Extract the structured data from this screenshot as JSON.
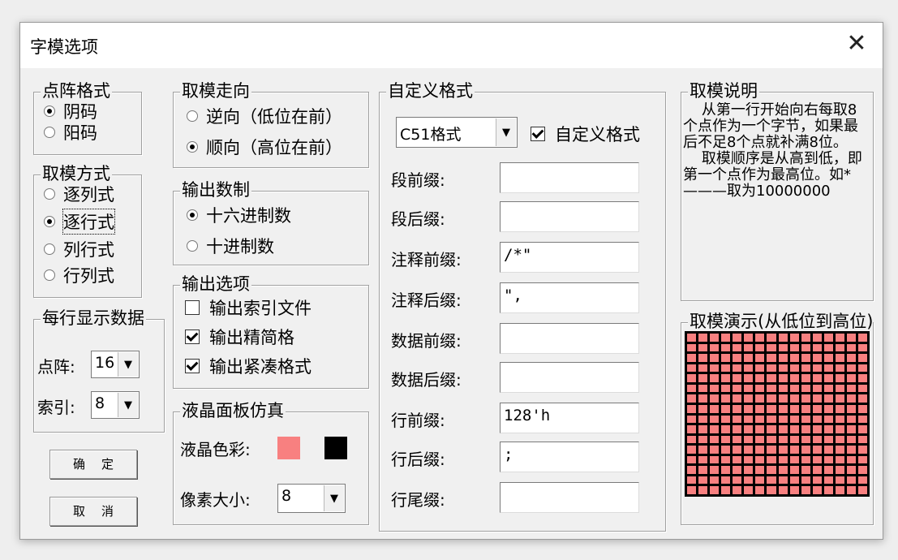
{
  "window": {
    "title": "字模选项",
    "close_glyph": "✕"
  },
  "dot_format": {
    "title": "点阵格式",
    "options": [
      {
        "label": "阴码",
        "selected": true
      },
      {
        "label": "阳码",
        "selected": false
      }
    ]
  },
  "mode": {
    "title": "取模方式",
    "options": [
      {
        "label": "逐列式",
        "selected": false
      },
      {
        "label": "逐行式",
        "selected": true
      },
      {
        "label": "列行式",
        "selected": false
      },
      {
        "label": "行列式",
        "selected": false
      }
    ]
  },
  "per_line": {
    "title": "每行显示数据",
    "dot_label": "点阵:",
    "dot_value": "16",
    "index_label": "索引:",
    "index_value": "8"
  },
  "buttons": {
    "ok": "确定",
    "cancel": "取消"
  },
  "direction": {
    "title": "取模走向",
    "options": [
      {
        "label": "逆向（低位在前）",
        "selected": false
      },
      {
        "label": "顺向（高位在前）",
        "selected": true
      }
    ]
  },
  "radix": {
    "title": "输出数制",
    "options": [
      {
        "label": "十六进制数",
        "selected": true
      },
      {
        "label": "十进制数",
        "selected": false
      }
    ]
  },
  "output": {
    "title": "输出选项",
    "options": [
      {
        "label": "输出索引文件",
        "checked": false
      },
      {
        "label": "输出精简格",
        "checked": true
      },
      {
        "label": "输出紧凑格式",
        "checked": true
      }
    ]
  },
  "lcd": {
    "title": "液晶面板仿真",
    "color_label": "液晶色彩:",
    "color_on": "#f88080",
    "color_off": "#000000",
    "pixel_label": "像素大小:",
    "pixel_value": "8"
  },
  "custom": {
    "title": "自定义格式",
    "format_value": "C51格式",
    "custom_check_label": "自定义格式",
    "custom_checked": true,
    "fields": [
      {
        "label": "段前缀:",
        "value": ""
      },
      {
        "label": "段后缀:",
        "value": ""
      },
      {
        "label": "注释前缀:",
        "value": "/*\""
      },
      {
        "label": "注释后缀:",
        "value": "\","
      },
      {
        "label": "数据前缀:",
        "value": ""
      },
      {
        "label": "数据后缀:",
        "value": ""
      },
      {
        "label": "行前缀:",
        "value": "128'h"
      },
      {
        "label": "行后缀:",
        "value": ";"
      },
      {
        "label": "行尾缀:",
        "value": ""
      }
    ]
  },
  "explain": {
    "title": "取模说明",
    "text": "    从第一行开始向右每取8个点作为一个字节，如果最后不足8个点就补满8位。\n    取模顺序是从高到低，即第一个点作为最高位。如*———取为10000000"
  },
  "demo": {
    "title": "取模演示(从低位到高位)",
    "rows": 16,
    "cols": 16,
    "cell_color": "#f88080",
    "grid_color": "#000000"
  }
}
